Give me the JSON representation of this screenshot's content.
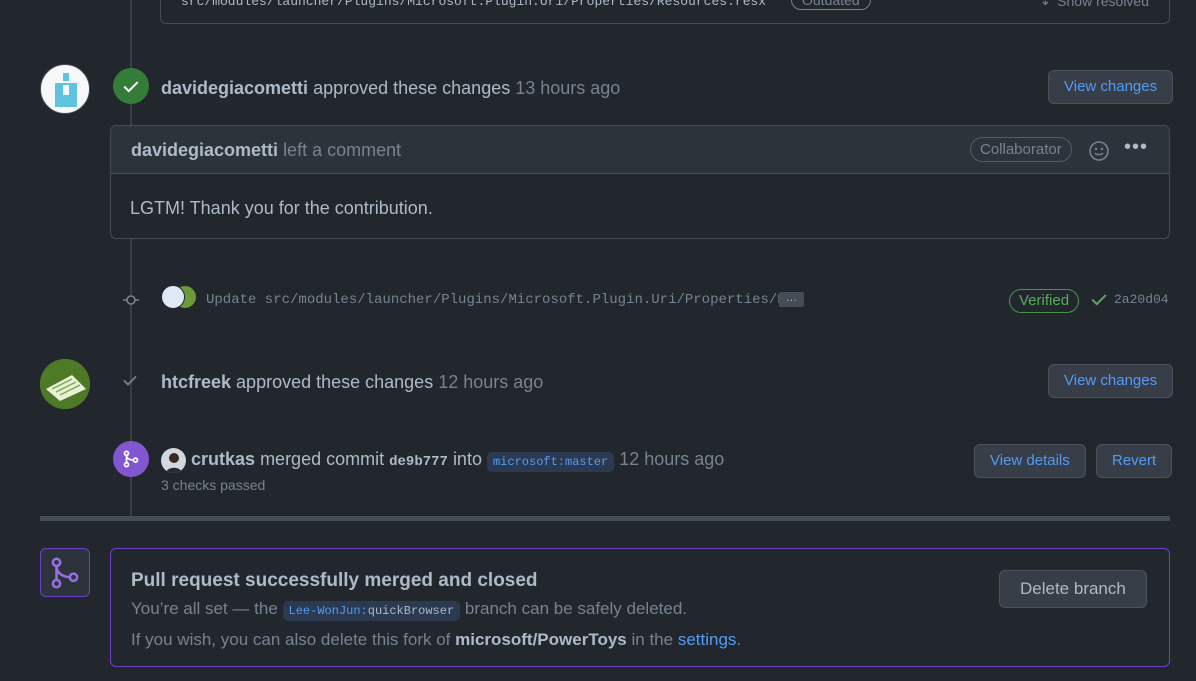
{
  "top_file": {
    "path": "src/modules/launcher/Plugins/Microsoft.Plugin.Uri/Properties/Resources.resx",
    "outdated_label": "Outdated",
    "show_resolved_label": "Show resolved"
  },
  "review1": {
    "user": "davidegiacometti",
    "action": "approved these changes",
    "time": "13 hours ago",
    "view_changes_label": "View changes"
  },
  "comment": {
    "user": "davidegiacometti",
    "action": "left a comment",
    "role_badge": "Collaborator",
    "body": "LGTM! Thank you for the contribution."
  },
  "commit": {
    "message": "Update src/modules/launcher/Plugins/Microsoft.Plugin.Uri/Properties/R…",
    "ellipsis": "…",
    "verified_label": "Verified",
    "sha": "2a20d04"
  },
  "review2": {
    "user": "htcfreek",
    "action": "approved these changes",
    "time": "12 hours ago",
    "view_changes_label": "View changes"
  },
  "merge_event": {
    "user": "crutkas",
    "action": "merged commit",
    "commit_sha": "de9b777",
    "into_label": "into",
    "target_repo": "microsoft",
    "target_branch": "master",
    "time": "12 hours ago",
    "checks": "3 checks passed",
    "view_details_label": "View details",
    "revert_label": "Revert"
  },
  "merged_box": {
    "title": "Pull request successfully merged and closed",
    "line1_prefix": "You’re all set — the",
    "branch_owner": "Lee-WonJun",
    "branch_name": "quickBrowser",
    "line1_suffix": "branch can be safely deleted.",
    "line2_prefix": "If you wish, you can also delete this fork of",
    "repo": "microsoft/PowerToys",
    "line2_mid": "in the",
    "settings_link": "settings",
    "line2_end": ".",
    "delete_branch_label": "Delete branch"
  },
  "colors": {
    "background": "#22272e",
    "approve_green": "#347d39",
    "merge_purple": "#8256d0",
    "link_blue": "#539bf5"
  }
}
